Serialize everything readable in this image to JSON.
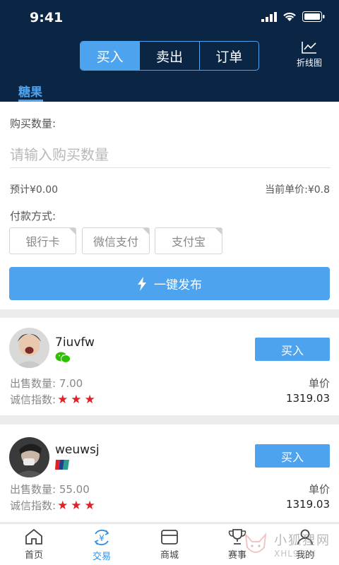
{
  "status_bar": {
    "time": "9:41"
  },
  "header": {
    "segments": [
      "买入",
      "卖出",
      "订单"
    ],
    "active_segment": 0,
    "chart_label": "折线图",
    "category_tab": "糖果"
  },
  "form": {
    "qty_label": "购买数量:",
    "qty_placeholder": "请输入购买数量",
    "estimate": "预计¥0.00",
    "unit_price": "当前单价:¥0.8",
    "pay_label": "付款方式:",
    "pay_methods": [
      "银行卡",
      "微信支付",
      "支付宝"
    ],
    "publish_label": "一键发布"
  },
  "listings": [
    {
      "username": "7iuvfw",
      "badge_icon": "wechat-icon",
      "sell_qty": "出售数量: 7.00",
      "credit_label": "诚信指数:",
      "stars": "★★★",
      "buy_label": "买入",
      "unit_price_label": "单价",
      "unit_price": "1319.03"
    },
    {
      "username": "weuwsj",
      "badge_icon": "bank-card-icon",
      "sell_qty": "出售数量: 55.00",
      "credit_label": "诚信指数:",
      "stars": "★★★",
      "buy_label": "买入",
      "unit_price_label": "单价",
      "unit_price": "1319.03"
    }
  ],
  "tabbar": {
    "items": [
      "首页",
      "交易",
      "商城",
      "赛事",
      "我的"
    ],
    "active": 1
  },
  "watermark": {
    "cn": "小狐狸网",
    "en": "XHL9.CN"
  },
  "colors": {
    "header_bg": "#0b2545",
    "accent": "#4ea3ee",
    "star": "#e01f26"
  }
}
